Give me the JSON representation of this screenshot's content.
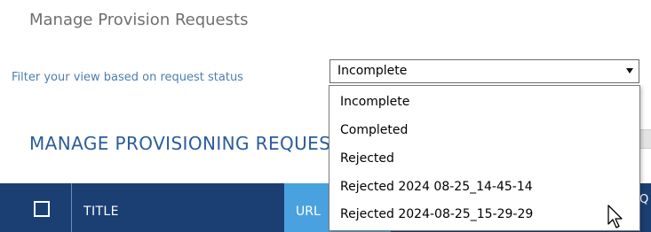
{
  "page": {
    "title": "Manage Provision Requests"
  },
  "filter": {
    "label": "Filter your view based on request status",
    "selected": "Incomplete",
    "options": [
      "Incomplete",
      "Completed",
      "Rejected",
      "Rejected 2024 08-25_14-45-14",
      "Rejected 2024-08-25_15-29-29"
    ]
  },
  "section": {
    "heading": "MANAGE PROVISIONING REQUESTS"
  },
  "table": {
    "headers": {
      "title": "TITLE",
      "url": "URL",
      "right_fragment": "Q"
    }
  },
  "colors": {
    "header_bg": "#1b3f73",
    "url_header_bg": "#4aa1df",
    "heading_text": "#2a5d9a",
    "label_text": "#4a7fb0"
  },
  "icons": {
    "dropdown_arrow": "chevron-down-icon",
    "cursor": "mouse-pointer-icon",
    "header_checkbox": "checkbox-icon"
  }
}
